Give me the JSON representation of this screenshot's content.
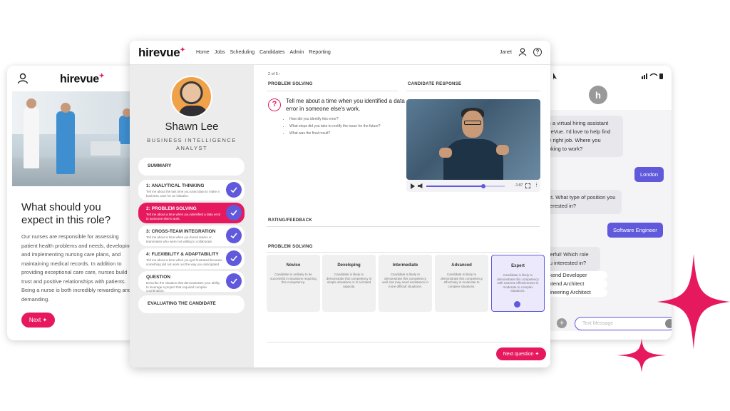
{
  "left_card": {
    "logo": "hirevue",
    "title": "What should you expect in this role?",
    "body": "Our nurses are responsible for assessing patient health problems and needs, developing and implementing nursing care plans, and maintaining medical records. In addition to providing exceptional care care, nurses build trust and positive relationships with patients. Being a nurse is both incredibly rewarding and demanding.",
    "next_button": "Next ✦"
  },
  "main": {
    "logo": "hirevue",
    "nav": [
      "Home",
      "Jobs",
      "Scheduling",
      "Candidates",
      "Admin",
      "Reporting"
    ],
    "user_name": "Janet",
    "profile": {
      "name": "Shawn Lee",
      "role": "BUSINESS INTELLIGENCE ANALYST"
    },
    "summary_label": "SUMMARY",
    "competencies": [
      {
        "title": "1: ANALYTICAL THINKING",
        "desc": "Tell me about the last time you used data to make a business case for an initiative."
      },
      {
        "title": "2: PROBLEM SOLVING",
        "desc": "Tell me about a time when you identified a data error in someone else's work."
      },
      {
        "title": "3: CROSS-TEAM INTEGRATION",
        "desc": "Tell me about a time when you faced teams or teammates who were not willing to collaborate."
      },
      {
        "title": "4: FLEXIBILITY & ADAPTABILITY",
        "desc": "Tell me about a time when you got frustrated because something did not work out the way you anticipated."
      },
      {
        "title": "QUESTION",
        "desc": "Describe the situation that demonstrates your ability to leverage a project that required complex coordination."
      }
    ],
    "evaluating_label": "EVALUATING THE CANDIDATE",
    "pager": "2 of 5",
    "problem_solving_label": "PROBLEM SOLVING",
    "candidate_response_label": "CANDIDATE RESPONSE",
    "question": "Tell me about a time when you identified a data error in someone else's work.",
    "bullets": [
      "How did you identify this error?",
      "What steps did you take to rectify the issue for the future?",
      "What was the final result?"
    ],
    "video_time": "-1:07",
    "rating_label": "RATING/FEEDBACK",
    "problem_solving_label_2": "PROBLEM SOLVING",
    "ratings": [
      {
        "level": "Novice",
        "desc": "Candidate is unlikely to be successful in situations requiring this competency."
      },
      {
        "level": "Developing",
        "desc": "Candidate is likely to demonstrate this competency in simple situations or in a limited capacity."
      },
      {
        "level": "Intermediate",
        "desc": "Candidate is likely to demonstrate this competency well, but may need assistance in more difficult situations."
      },
      {
        "level": "Advanced",
        "desc": "Candidate is likely to demonstrate this competency effectively in moderate to complex situations."
      },
      {
        "level": "Expert",
        "desc": "Candidate is likely to demonstrate this competency with extreme effectiveness in moderate to complex situations."
      }
    ],
    "selected_rating": "Expert",
    "next_question": "Next question ✦"
  },
  "chat": {
    "avatar_letter": "h",
    "messages": [
      {
        "from": "bot",
        "text": "I'm a virtual hiring assistant HireVue. I'd love to help find the right job. Where you looking to work?"
      },
      {
        "from": "user",
        "text": "London"
      },
      {
        "from": "bot",
        "text": "fect. What type of position you interested in?"
      },
      {
        "from": "user",
        "text": "Software Engineer"
      },
      {
        "from": "bot",
        "text": "nderful! Which role you interested in?"
      },
      {
        "from": "bot",
        "text": "ackend Developer"
      },
      {
        "from": "bot",
        "text": "rontend Architect"
      },
      {
        "from": "bot",
        "text": "ngineering Architect"
      }
    ],
    "input_placeholder": "Text Message"
  },
  "colors": {
    "brand_pink": "#e6195f",
    "accent_purple": "#6159db"
  }
}
